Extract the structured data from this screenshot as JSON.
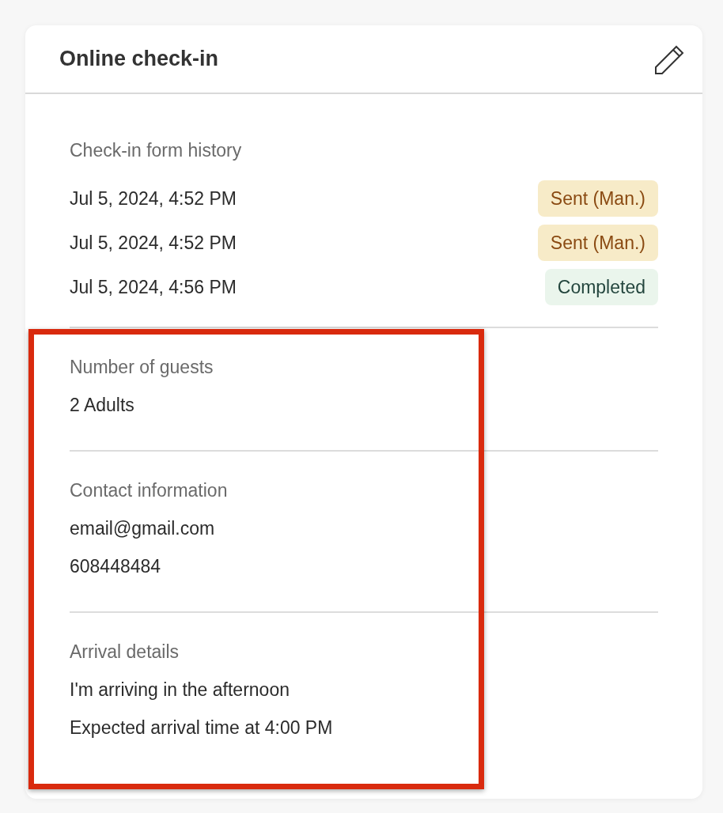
{
  "card": {
    "title": "Online check-in"
  },
  "history": {
    "heading": "Check-in form history",
    "entries": [
      {
        "date": "Jul 5, 2024, 4:52 PM",
        "status": "Sent (Man.)",
        "kind": "sent"
      },
      {
        "date": "Jul 5, 2024, 4:52 PM",
        "status": "Sent (Man.)",
        "kind": "sent"
      },
      {
        "date": "Jul 5, 2024, 4:56 PM",
        "status": "Completed",
        "kind": "completed"
      }
    ]
  },
  "sections": [
    {
      "heading": "Number of guests",
      "lines": [
        "2 Adults"
      ]
    },
    {
      "heading": "Contact information",
      "lines": [
        "email@gmail.com",
        "608448484"
      ]
    },
    {
      "heading": "Arrival details",
      "lines": [
        "I'm arriving in the afternoon",
        "Expected arrival time at 4:00 PM"
      ]
    }
  ],
  "highlight": {
    "shown": true
  }
}
